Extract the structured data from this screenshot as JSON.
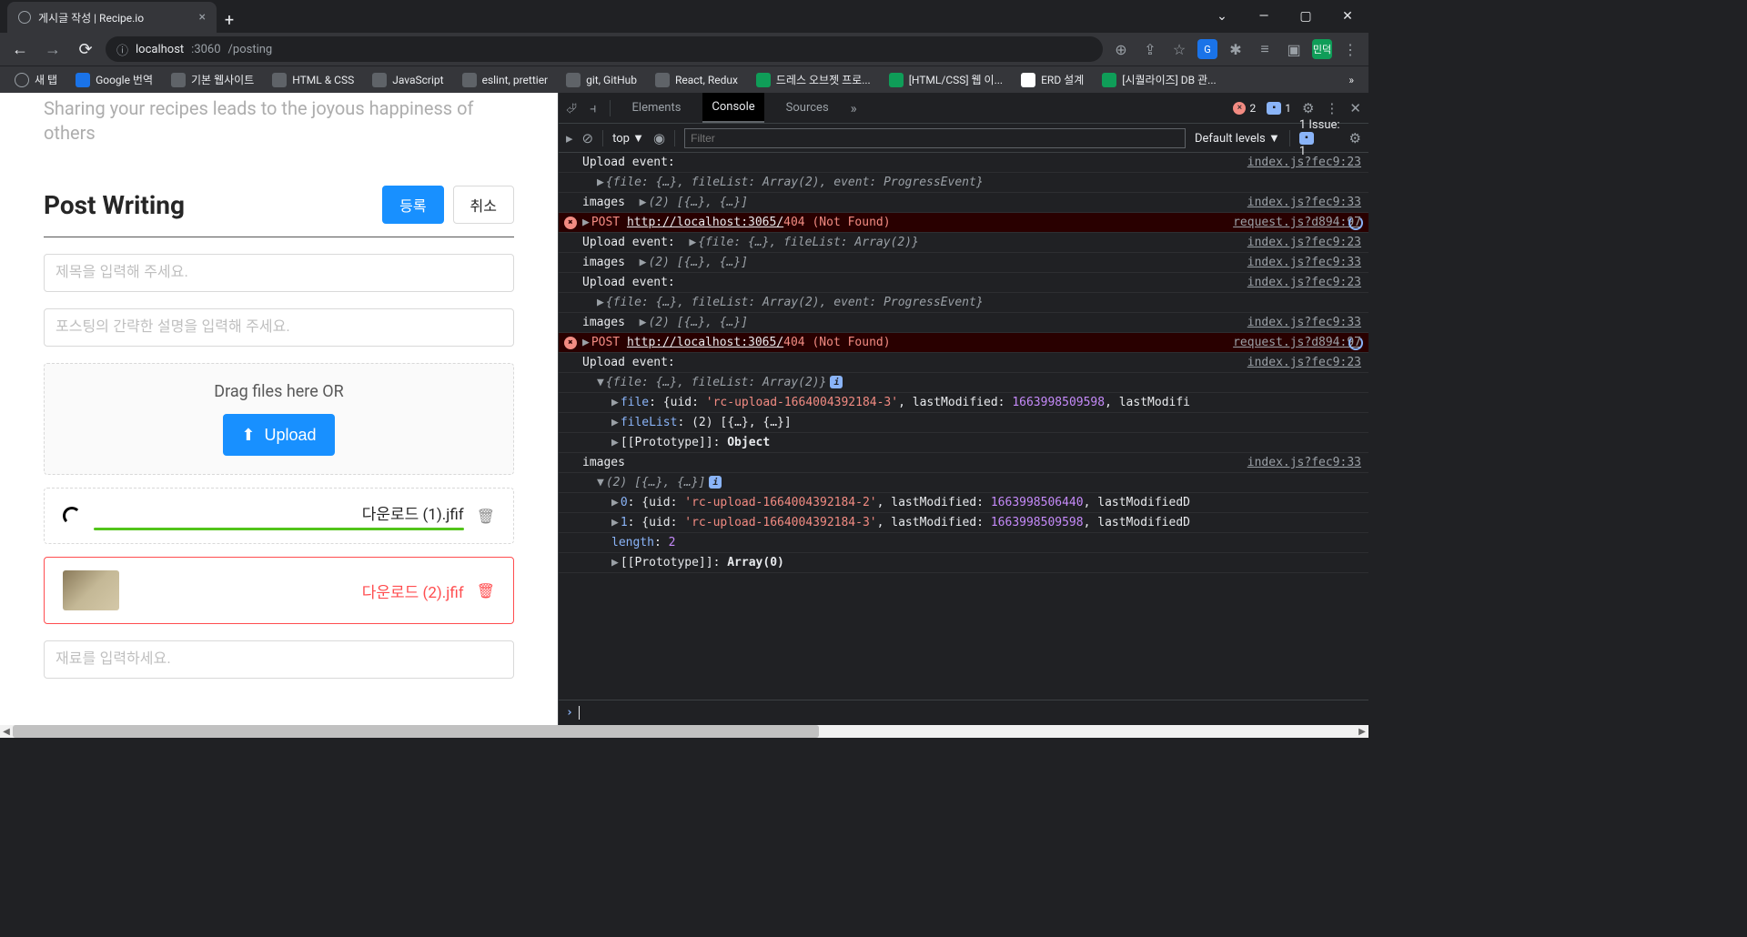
{
  "browser": {
    "tab_title": "게시글 작성 | Recipe.io",
    "url_host": "localhost",
    "url_port": ":3060",
    "url_path": "/posting",
    "bookmarks": [
      {
        "label": "새 탭",
        "icon": "globe"
      },
      {
        "label": "Google 번역",
        "icon": "blue"
      },
      {
        "label": "기본 웹사이트",
        "icon": "folder"
      },
      {
        "label": "HTML & CSS",
        "icon": "folder"
      },
      {
        "label": "JavaScript",
        "icon": "folder"
      },
      {
        "label": "eslint, prettier",
        "icon": "folder"
      },
      {
        "label": "git, GitHub",
        "icon": "folder"
      },
      {
        "label": "React, Redux",
        "icon": "folder"
      },
      {
        "label": "드레스 오브젯 프로...",
        "icon": "green"
      },
      {
        "label": "[HTML/CSS] 웹 이...",
        "icon": "green"
      },
      {
        "label": "ERD 설계",
        "icon": "white"
      },
      {
        "label": "[시퀄라이즈] DB 관...",
        "icon": "green"
      }
    ]
  },
  "app": {
    "subtitle": "Sharing your recipes leads to the joyous happiness of others",
    "heading": "Post Writing",
    "submit": "등록",
    "cancel": "취소",
    "title_placeholder": "제목을 입력해 주세요.",
    "desc_placeholder": "포스팅의 간략한 설명을 입력해 주세요.",
    "drag_text": "Drag files here OR",
    "upload_btn": "Upload",
    "file1": "다운로드 (1).jfif",
    "file2": "다운로드 (2).jfif",
    "ingredient_placeholder": "재료를 입력하세요."
  },
  "devtools": {
    "tabs": {
      "elements": "Elements",
      "console": "Console",
      "sources": "Sources"
    },
    "err_count": "2",
    "msg_count": "1",
    "context": "top",
    "filter_placeholder": "Filter",
    "levels": "Default levels",
    "issues_label": "1 Issue:",
    "issues_count": "1",
    "logs": [
      {
        "type": "log",
        "text": "Upload event:",
        "src": "index.js?fec9:23"
      },
      {
        "type": "sub",
        "prefix": "▶",
        "ital": "{file: {…}, fileList: Array(2), event: ProgressEvent}"
      },
      {
        "type": "log",
        "text": "images ",
        "prefix": "▶",
        "ital": "(2) [{…}, {…}]",
        "src": "index.js?fec9:33"
      },
      {
        "type": "error",
        "method": "POST",
        "url": "http://localhost:3065/",
        "status": "404 (Not Found)",
        "src": "request.js?d894:97",
        "swirl": true
      },
      {
        "type": "log",
        "text": "Upload event: ",
        "prefix": "▶",
        "ital": "{file: {…}, fileList: Array(2)}",
        "src": "index.js?fec9:23"
      },
      {
        "type": "log",
        "text": "images ",
        "prefix": "▶",
        "ital": "(2) [{…}, {…}]",
        "src": "index.js?fec9:33"
      },
      {
        "type": "log",
        "text": "Upload event:",
        "src": "index.js?fec9:23"
      },
      {
        "type": "sub",
        "prefix": "▶",
        "ital": "{file: {…}, fileList: Array(2), event: ProgressEvent}"
      },
      {
        "type": "log",
        "text": "images ",
        "prefix": "▶",
        "ital": "(2) [{…}, {…}]",
        "src": "index.js?fec9:33"
      },
      {
        "type": "error",
        "method": "POST",
        "url": "http://localhost:3065/",
        "status": "404 (Not Found)",
        "src": "request.js?d894:97",
        "swirl": true
      },
      {
        "type": "log",
        "text": "Upload event:",
        "src": "index.js?fec9:23"
      },
      {
        "type": "sub",
        "prefix": "▼",
        "ital": "{file: {…}, fileList: Array(2)}",
        "info": true
      },
      {
        "type": "sub2",
        "prefix": "▶",
        "prop": "file",
        "after": ": {uid: ",
        "str": "'rc-upload-1664004392184-3'",
        "tail": ", lastModified: ",
        "num": "1663998509598",
        "end": ", lastModifi"
      },
      {
        "type": "sub2",
        "prefix": "▶",
        "prop": "fileList",
        "after": ": (2) [{…}, {…}]"
      },
      {
        "type": "sub2",
        "prefix": "▶",
        "plain": "[[Prototype]]: ",
        "bold": "Object"
      },
      {
        "type": "log",
        "text": "images",
        "src": "index.js?fec9:33"
      },
      {
        "type": "sub",
        "prefix": "▼",
        "ital": "(2) [{…}, {…}]",
        "info": true
      },
      {
        "type": "sub2",
        "prefix": "▶",
        "prop": "0",
        "after": ": {uid: ",
        "str": "'rc-upload-1664004392184-2'",
        "tail": ", lastModified: ",
        "num": "1663998506440",
        "end": ", lastModifiedD"
      },
      {
        "type": "sub2",
        "prefix": "▶",
        "prop": "1",
        "after": ": {uid: ",
        "str": "'rc-upload-1664004392184-3'",
        "tail": ", lastModified: ",
        "num": "1663998509598",
        "end": ", lastModifiedD"
      },
      {
        "type": "sub2",
        "plain": "",
        "prop": "length",
        "after": ": ",
        "num": "2"
      },
      {
        "type": "sub2",
        "prefix": "▶",
        "plain": "[[Prototype]]: ",
        "bold": "Array(0)"
      }
    ]
  }
}
